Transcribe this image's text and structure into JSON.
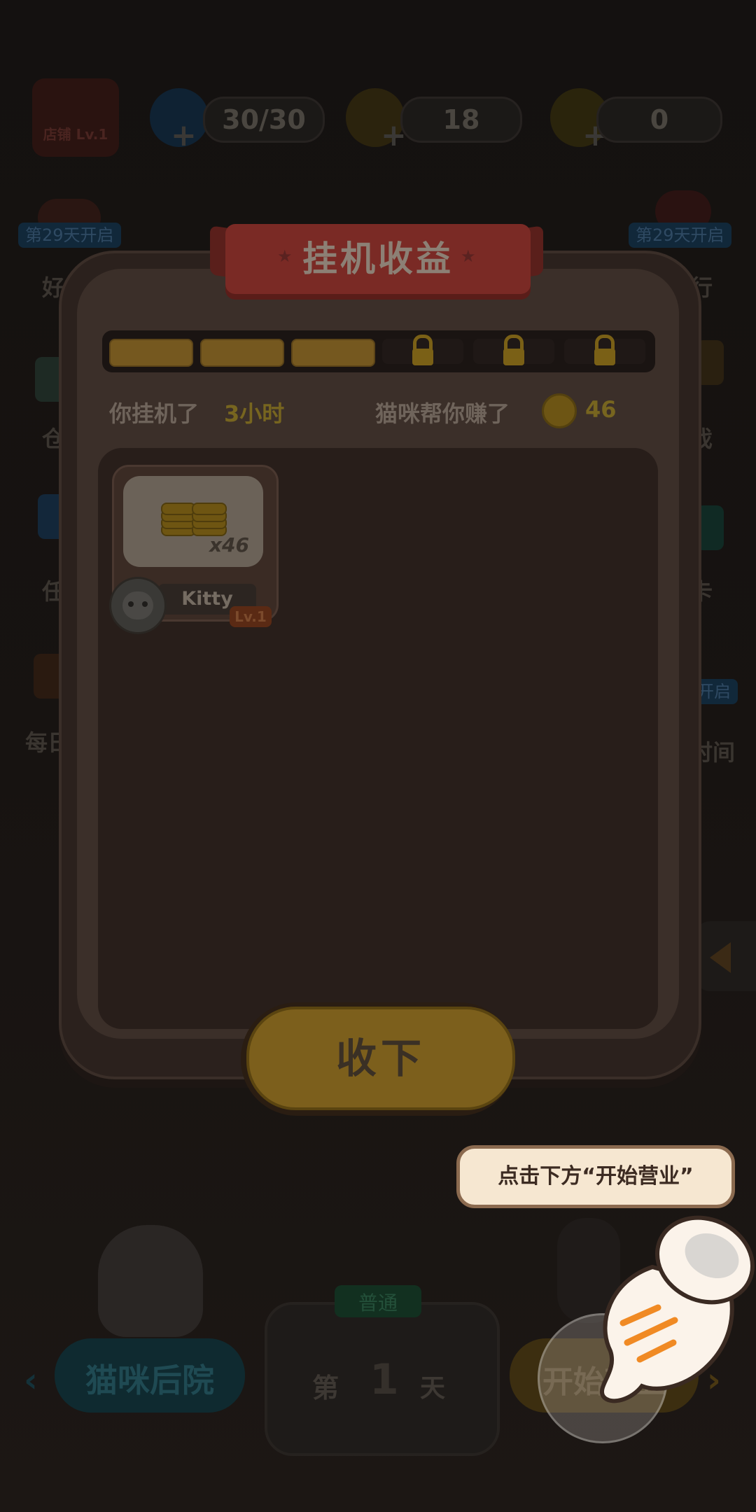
{
  "top_bar": {
    "shop_label": "店铺 Lv.1",
    "energy": "30/30",
    "coins": "18",
    "stars": "0"
  },
  "side_left": {
    "badge_1": "第29天开启",
    "label_1": "好",
    "label_2": "仓",
    "label_3": "任",
    "label_4": "每日"
  },
  "side_right": {
    "badge_1": "第29天开启",
    "label_1": "行",
    "label_2": "戏",
    "label_3": "卡",
    "badge_2": "开启",
    "label_4": "时间"
  },
  "modal": {
    "title": "挂机收益",
    "progress": {
      "filled_segments": 3,
      "total_segments": 6
    },
    "idle_label": "你挂机了",
    "idle_value": "3小时",
    "earned_label": "猫咪帮你赚了",
    "earned_value": "46",
    "reward": {
      "count": "x46",
      "cat_name": "Kitty",
      "cat_level": "Lv.1"
    },
    "collect_label": "收下"
  },
  "tooltip": {
    "text": "点击下方“开始营业”"
  },
  "bottom": {
    "backyard_label": "猫咪后院",
    "mode_label": "普通",
    "day_prefix": "第",
    "day_number": "1",
    "day_suffix": "天",
    "start_label": "开始营业"
  },
  "colors": {
    "gold": "#e8b53a",
    "ribbon_red": "#c0392b",
    "panel_brown": "#5a4338",
    "tooltip_bg": "#f6e7d1"
  }
}
